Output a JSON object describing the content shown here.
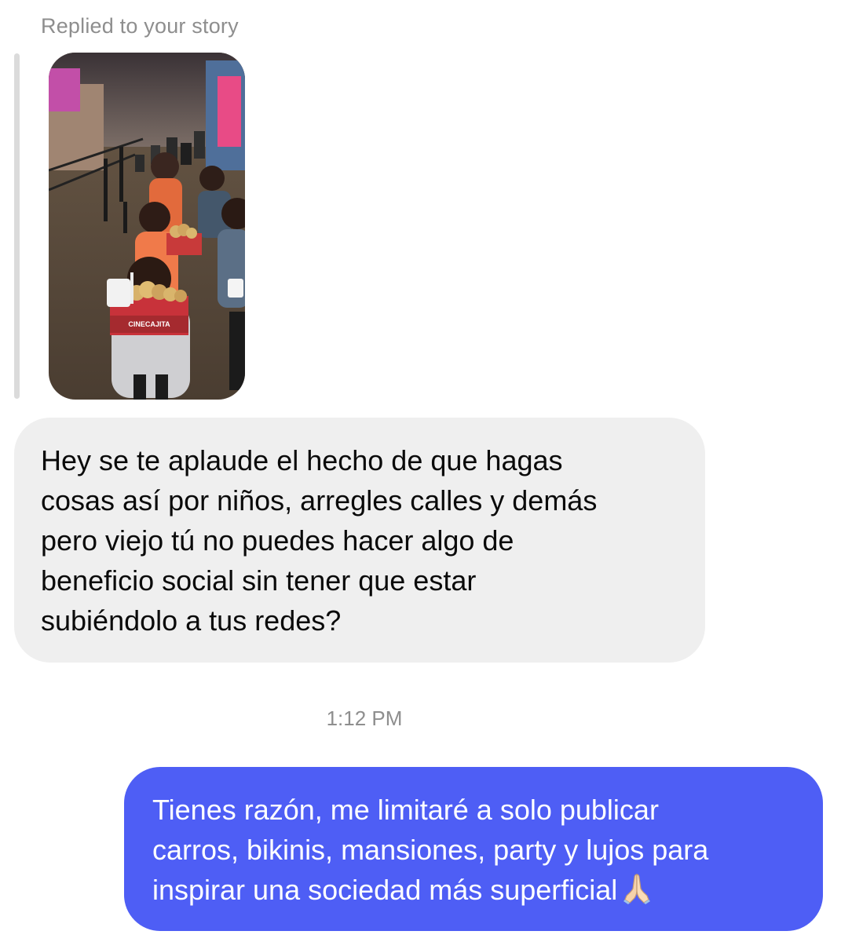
{
  "thread": {
    "reply_context": "Replied to your story",
    "story_image_text": "CINECAJITA",
    "incoming_message": {
      "text": "Hey se te aplaude el hecho de que hagas\ncosas así por niños, arregles calles y demás\npero viejo tú no puedes hacer algo de\nbeneficio social sin tener que estar\nsubiéndolo a tus redes?"
    },
    "timestamp": "1:12 PM",
    "outgoing_message": {
      "text": "Tienes razón, me limitaré a solo publicar\ncarros, bikinis, mansiones, party y lujos para\ninspirar una sociedad más superficial",
      "emoji": "folded-hands-icon"
    }
  },
  "colors": {
    "incoming_bubble": "#efefef",
    "outgoing_bubble": "#4e5ef5",
    "muted_text": "#8e8e8e"
  }
}
